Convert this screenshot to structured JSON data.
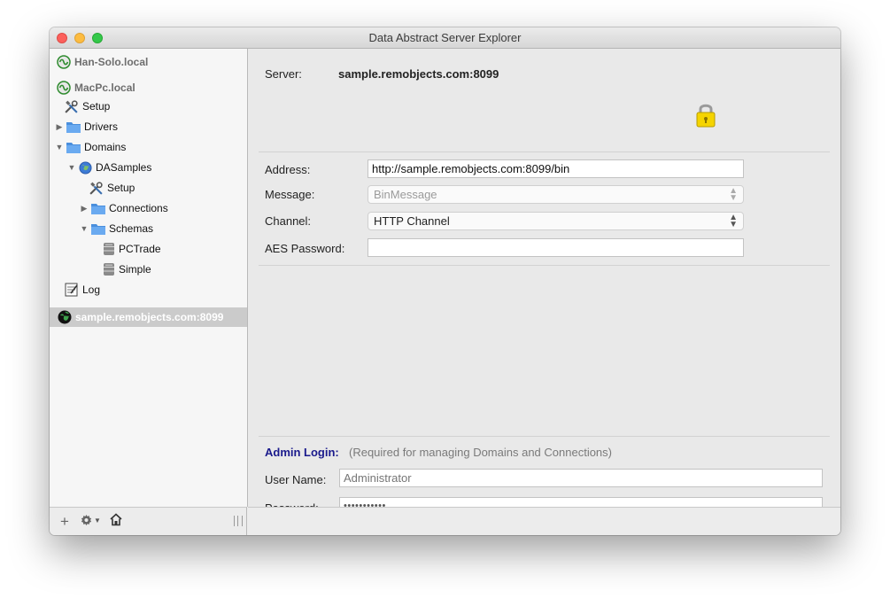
{
  "window": {
    "title": "Data Abstract Server Explorer"
  },
  "sidebar": {
    "hosts": [
      {
        "label": "Han-Solo.local"
      },
      {
        "label": "MacPc.local"
      }
    ],
    "tree": {
      "setup": "Setup",
      "drivers": "Drivers",
      "domains": "Domains",
      "dasamples": "DASamples",
      "dasamples_setup": "Setup",
      "connections": "Connections",
      "schemas": "Schemas",
      "pctrade": "PCTrade",
      "simple": "Simple",
      "log": "Log"
    },
    "selected_server": "sample.remobjects.com:8099"
  },
  "main": {
    "server_label": "Server:",
    "server_value": "sample.remobjects.com:8099",
    "address_label": "Address:",
    "address_value": "http://sample.remobjects.com:8099/bin",
    "message_label": "Message:",
    "message_value": "BinMessage",
    "channel_label": "Channel:",
    "channel_value": "HTTP Channel",
    "aes_label": "AES Password:",
    "aes_value": "",
    "admin_login_label": "Admin Login:",
    "admin_login_note": "(Required for managing Domains and Connections)",
    "username_label": "User Name:",
    "username_placeholder": "Administrator",
    "password_label": "Password:",
    "password_value": "•••••••••••"
  },
  "colors": {
    "admin_accent": "#1a1a8c",
    "lock": "#f5d400",
    "selection": "#cbcbcb"
  }
}
